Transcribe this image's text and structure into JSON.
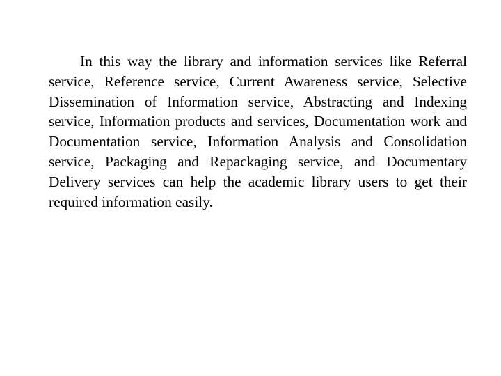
{
  "slide": {
    "paragraph": "In this way the library and information services like Referral service, Reference service, Current Awareness service, Selective Dissemination of Information service, Abstracting and Indexing service, Information products and services, Documentation work and Documentation service, Information Analysis and Consolidation service, Packaging and Repackaging service, and Documentary Delivery services can help the academic library users to get their required information easily."
  }
}
